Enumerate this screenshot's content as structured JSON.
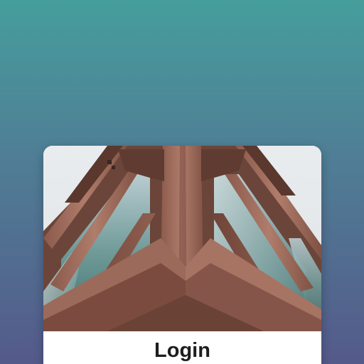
{
  "card": {
    "title": "Login",
    "hero_image": "building-facade-photo"
  },
  "colors": {
    "background_top": "#459e9c",
    "background_bottom": "#545a8a",
    "card": "#ffffff",
    "title_text": "#1e1e1e"
  }
}
